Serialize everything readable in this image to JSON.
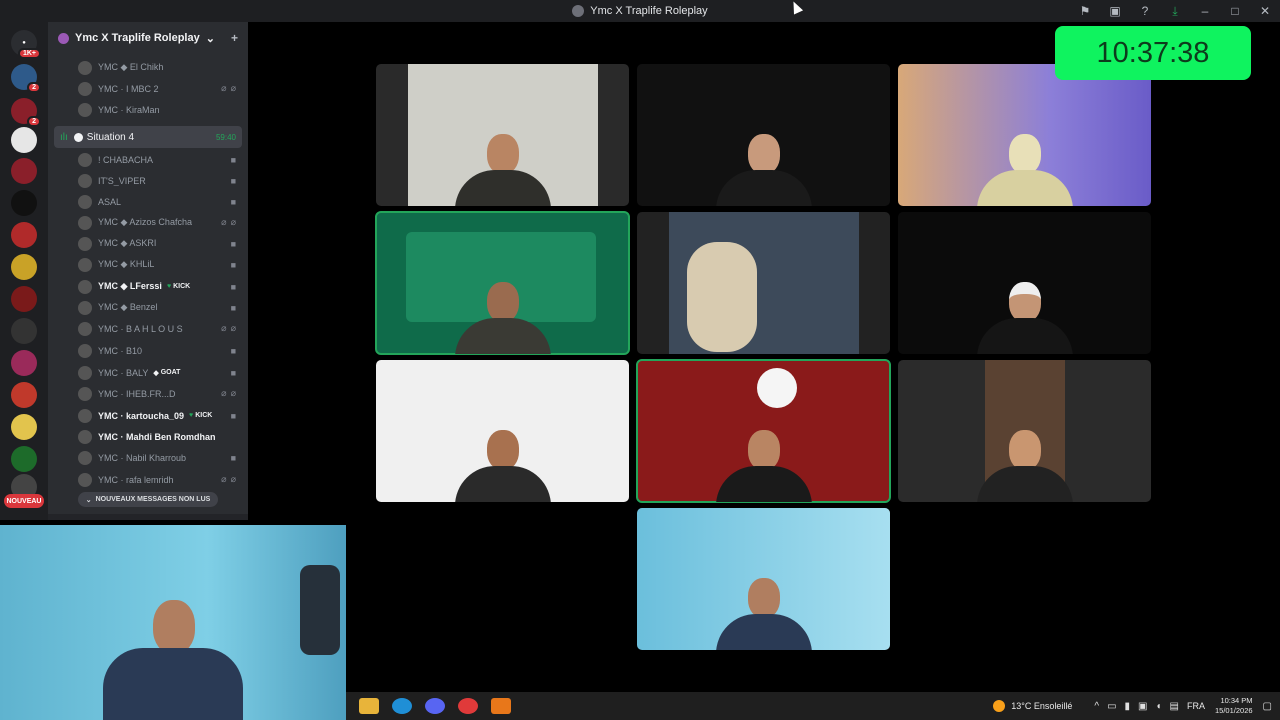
{
  "window": {
    "title": "Ymc X Traplife Roleplay"
  },
  "servers": {
    "badges": [
      "1K+",
      "2",
      "2"
    ],
    "nouveau": "NOUVEAU"
  },
  "guild": {
    "name": "Ymc X Traplife Roleplay"
  },
  "voice_channel": {
    "name": "Situation 4",
    "timer": "59:40"
  },
  "members_top": [
    {
      "name": "YMC ◆ El Chikh"
    },
    {
      "name": "YMC · I MBC 2"
    },
    {
      "name": "YMC · KiraMan"
    }
  ],
  "members": [
    {
      "name": "! CHABACHA",
      "bright": false
    },
    {
      "name": "IT'S_VIPER",
      "bright": false
    },
    {
      "name": "ASAL",
      "bright": false
    },
    {
      "name": "YMC ◆ Azizos Chafcha",
      "bright": false
    },
    {
      "name": "YMC ◆ ASKRI",
      "bright": false
    },
    {
      "name": "YMC ◆ KHLiL",
      "bright": false
    },
    {
      "name": "YMC ◆ LFerssi",
      "bright": true,
      "tag": "KICK"
    },
    {
      "name": "YMC ◆ Benzel",
      "bright": false
    },
    {
      "name": "YMC · B A H L O U S",
      "bright": false
    },
    {
      "name": "YMC · B10",
      "bright": false
    },
    {
      "name": "YMC · BALY",
      "bright": false,
      "tag": "GOAT"
    },
    {
      "name": "YMC · IHEB.FR...D",
      "bright": false
    },
    {
      "name": "YMC · kartoucha_09",
      "bright": true,
      "tag": "KICK"
    },
    {
      "name": "YMC · Mahdi Ben Romdhan",
      "bright": true
    },
    {
      "name": "YMC · Nabil Kharroub",
      "bright": false
    },
    {
      "name": "YMC · rafa lemridh",
      "bright": false
    }
  ],
  "unread_banner": "NOUVEAUX MESSAGES NON LUS",
  "overlay_clock": "10:37:38",
  "taskbar": {
    "weather": "13°C  Ensoleillé",
    "language": "FRA",
    "time": "10:34 PM",
    "date": "15/01/2026"
  },
  "colors": {
    "accent_green": "#23a55a",
    "clock_bg": "#0ff35f",
    "unread_red": "#da373c"
  }
}
